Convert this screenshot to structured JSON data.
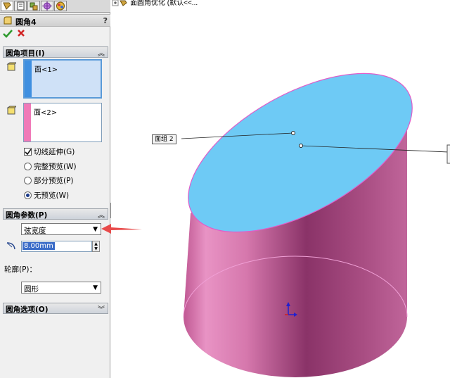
{
  "panel": {
    "title": "圆角4",
    "help": "?",
    "items_section": {
      "title": "圆角项目(I)",
      "list1_item": "面<1>",
      "list2_item": "面<2>",
      "tangent_label": "切线延伸(G)",
      "preview_options": [
        "完整预览(W)",
        "部分预览(P)",
        "无预览(W)"
      ],
      "selected_preview": 2
    },
    "params_section": {
      "title": "圆角参数(P)",
      "method": "弦宽度",
      "value": "8.00mm",
      "profile_label": "轮廓(P)：",
      "profile": "圆形"
    },
    "options_section": {
      "title": "圆角选项(O)"
    }
  },
  "viewport": {
    "tree_label": "面圆角优化 (默认<<...",
    "callout": "面组 2",
    "colors": {
      "top_face": "#6ecaf5",
      "body": "#d070a8",
      "edge": "#e15cc9",
      "arrow": "#e84a4a"
    }
  }
}
